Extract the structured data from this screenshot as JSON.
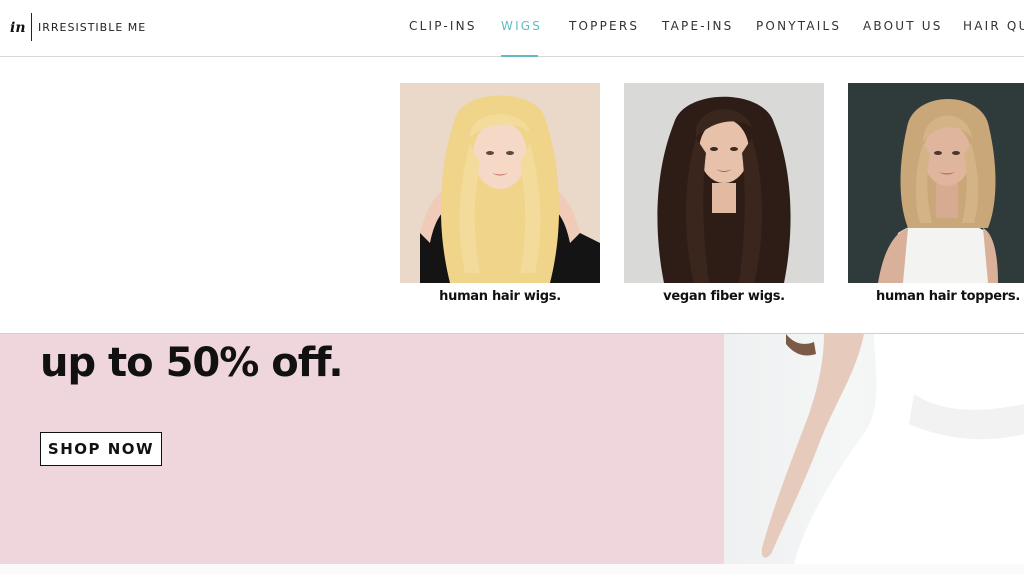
{
  "brand": {
    "name": "IRRESISTIBLE ME"
  },
  "nav": {
    "items": [
      {
        "label": "CLIP-INS"
      },
      {
        "label": "WIGS"
      },
      {
        "label": "TOPPERS"
      },
      {
        "label": "TAPE-INS"
      },
      {
        "label": "PONYTAILS"
      },
      {
        "label": "ABOUT US"
      },
      {
        "label": "HAIR QUI"
      }
    ],
    "active": "WIGS"
  },
  "mega_menu": {
    "cards": [
      {
        "caption": "human hair wigs.",
        "image": "blonde-long-wavy-hair-model"
      },
      {
        "caption": "vegan fiber wigs.",
        "image": "dark-long-wavy-hair-model"
      },
      {
        "caption": "human hair toppers.",
        "image": "blonde-shoulder-length-hair-model"
      }
    ]
  },
  "hero": {
    "title": "up to 50% off.",
    "cta": "SHOP NOW"
  },
  "colors": {
    "accent": "#5fbcc6",
    "hero_bg": "#efd6dc"
  }
}
